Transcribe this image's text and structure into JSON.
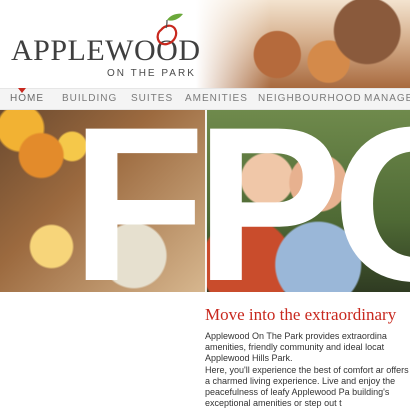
{
  "header": {
    "logo_main": "APPLEWOOD",
    "logo_sub": "ON THE PARK",
    "icons": [
      "apple-icon"
    ]
  },
  "nav": {
    "items": [
      {
        "label": "HOME",
        "active": true
      },
      {
        "label": "BUILDING"
      },
      {
        "label": "SUITES"
      },
      {
        "label": "AMENITIES"
      },
      {
        "label": "NEIGHBOURHOOD"
      },
      {
        "label": "MANAGEM"
      }
    ]
  },
  "hero": {
    "placeholder_text": "FPO"
  },
  "main": {
    "headline": "Move into the extraordinary",
    "paragraphs": [
      "Applewood On The Park provides extraordina amenities, friendly community and ideal locat Applewood Hills Park.",
      "Here, you'll experience the best of comfort ar offers a charmed living experience. Live and enjoy the peacefulness of leafy Applewood Pa building's exceptional amenities or step out t"
    ]
  },
  "colors": {
    "accent": "#c8281e",
    "nav_bg": "#f4f4f4",
    "text": "#333333"
  }
}
